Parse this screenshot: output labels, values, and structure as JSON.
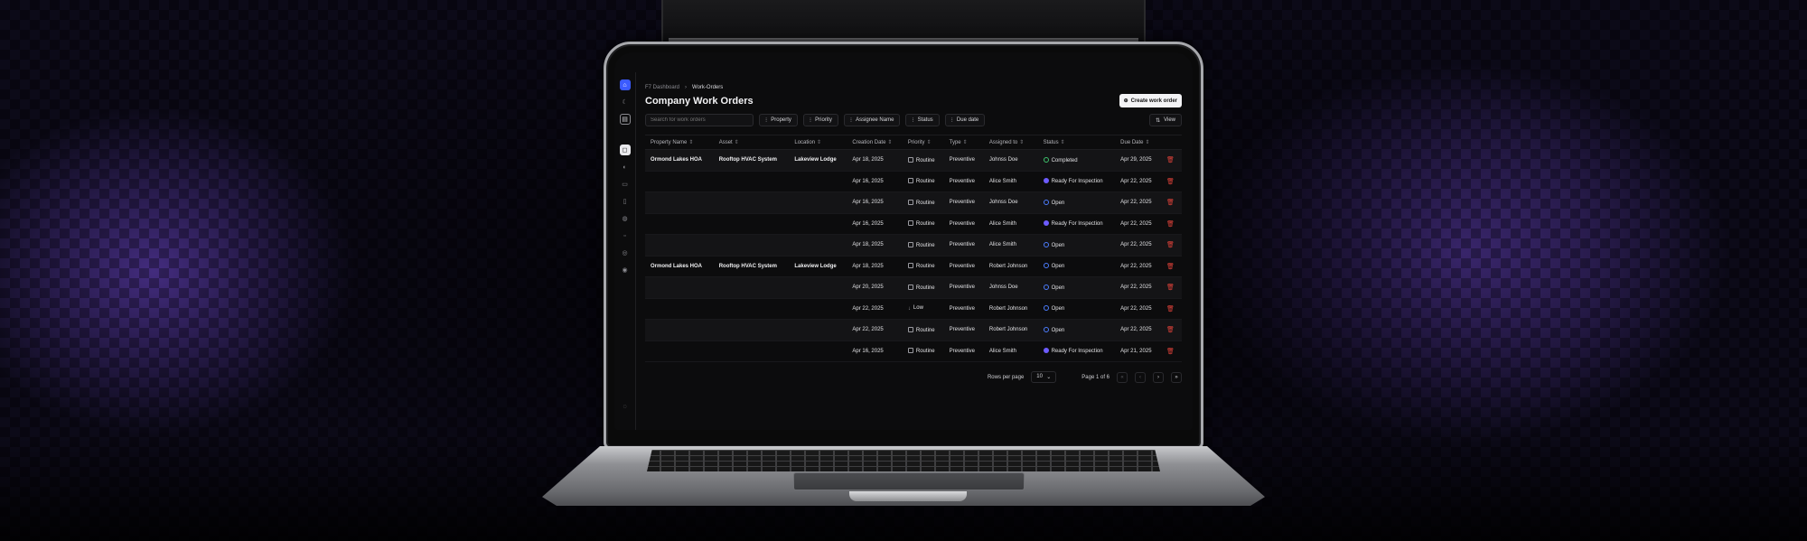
{
  "breadcrumb": {
    "root": "F7 Dashboard",
    "separator": "›",
    "current": "Work-Orders"
  },
  "page_title": "Company Work Orders",
  "create_button": {
    "icon": "plus-circle-icon",
    "label": "Create work order"
  },
  "search": {
    "placeholder": "Search for work orders"
  },
  "filters": [
    "Property",
    "Priority",
    "Assignee Name",
    "Status",
    "Due date"
  ],
  "view_button": {
    "icon": "sliders-icon",
    "label": "View"
  },
  "columns": [
    "Property Name",
    "Asset",
    "Location",
    "Creation Date",
    "Priority",
    "Type",
    "Assigned to",
    "Status",
    "Due Date"
  ],
  "rows": [
    {
      "property": "Ormond Lakes HOA",
      "asset": "Rooftop HVAC System",
      "location": "Lakeview Lodge",
      "created": "Apr 18, 2025",
      "priority": "Routine",
      "type": "Preventive",
      "assignee": "Johnss Doe",
      "status": "Completed",
      "due": "Apr 29, 2025"
    },
    {
      "property": "",
      "asset": "",
      "location": "",
      "created": "Apr 16, 2025",
      "priority": "Routine",
      "type": "Preventive",
      "assignee": "Alice Smith",
      "status": "Ready For Inspection",
      "due": "Apr 22, 2025"
    },
    {
      "property": "",
      "asset": "",
      "location": "",
      "created": "Apr 16, 2025",
      "priority": "Routine",
      "type": "Preventive",
      "assignee": "Johnss Doe",
      "status": "Open",
      "due": "Apr 22, 2025"
    },
    {
      "property": "",
      "asset": "",
      "location": "",
      "created": "Apr 16, 2025",
      "priority": "Routine",
      "type": "Preventive",
      "assignee": "Alice Smith",
      "status": "Ready For Inspection",
      "due": "Apr 22, 2025"
    },
    {
      "property": "",
      "asset": "",
      "location": "",
      "created": "Apr 18, 2025",
      "priority": "Routine",
      "type": "Preventive",
      "assignee": "Alice Smith",
      "status": "Open",
      "due": "Apr 22, 2025"
    },
    {
      "property": "Ormond Lakes HOA",
      "asset": "Rooftop HVAC System",
      "location": "Lakeview Lodge",
      "created": "Apr 18, 2025",
      "priority": "Routine",
      "type": "Preventive",
      "assignee": "Robert Johnson",
      "status": "Open",
      "due": "Apr 22, 2025"
    },
    {
      "property": "",
      "asset": "",
      "location": "",
      "created": "Apr 20, 2025",
      "priority": "Routine",
      "type": "Preventive",
      "assignee": "Johnss Doe",
      "status": "Open",
      "due": "Apr 22, 2025"
    },
    {
      "property": "",
      "asset": "",
      "location": "",
      "created": "Apr 22, 2025",
      "priority": "Low",
      "type": "Preventive",
      "assignee": "Robert Johnson",
      "status": "Open",
      "due": "Apr 22, 2025"
    },
    {
      "property": "",
      "asset": "",
      "location": "",
      "created": "Apr 22, 2025",
      "priority": "Routine",
      "type": "Preventive",
      "assignee": "Robert Johnson",
      "status": "Open",
      "due": "Apr 22, 2025"
    },
    {
      "property": "",
      "asset": "",
      "location": "",
      "created": "Apr 16, 2025",
      "priority": "Routine",
      "type": "Preventive",
      "assignee": "Alice Smith",
      "status": "Ready For Inspection",
      "due": "Apr 21, 2025"
    }
  ],
  "pagination": {
    "rows_label": "Rows per page",
    "rows_value": "10",
    "page_label": "Page 1 of 6"
  },
  "colors": {
    "accent": "#3b5bff",
    "completed": "#3ec46d",
    "ready": "#6d5cff",
    "open": "#4c7dff",
    "danger": "#e0423a"
  }
}
